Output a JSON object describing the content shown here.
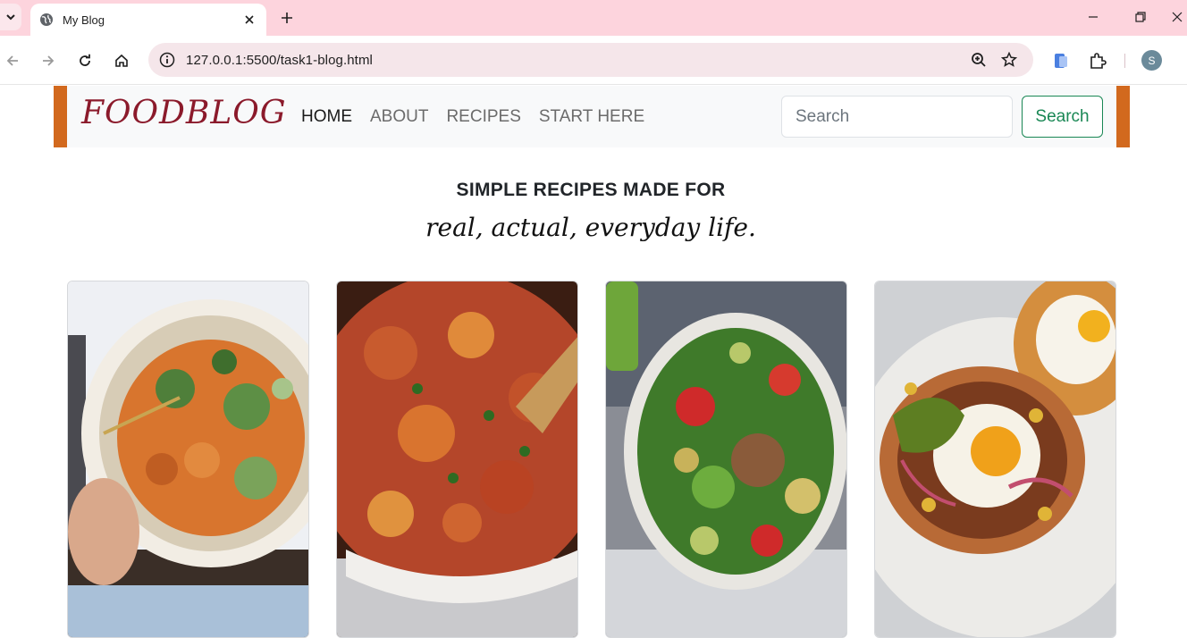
{
  "browser": {
    "tab_title": "My Blog",
    "url": "127.0.0.1:5500/task1-blog.html",
    "profile_initial": "S"
  },
  "navbar": {
    "brand": "FOODBLOG",
    "links": [
      "HOME",
      "ABOUT",
      "RECIPES",
      "START HERE"
    ],
    "active_link": "HOME",
    "search_placeholder": "Search",
    "search_button": "Search",
    "accent_color": "#d2691e",
    "brand_color": "#8b1a2b",
    "button_color": "#198754"
  },
  "hero": {
    "title": "SIMPLE RECIPES MADE FOR",
    "subtitle": "real, actual, everyday life."
  },
  "cards": [
    {
      "image": "noodle-salad-bowl-photo"
    },
    {
      "image": "chickpea-couscous-stew-photo"
    },
    {
      "image": "chicken-strawberry-salad-photo"
    },
    {
      "image": "egg-tostada-photo"
    }
  ]
}
